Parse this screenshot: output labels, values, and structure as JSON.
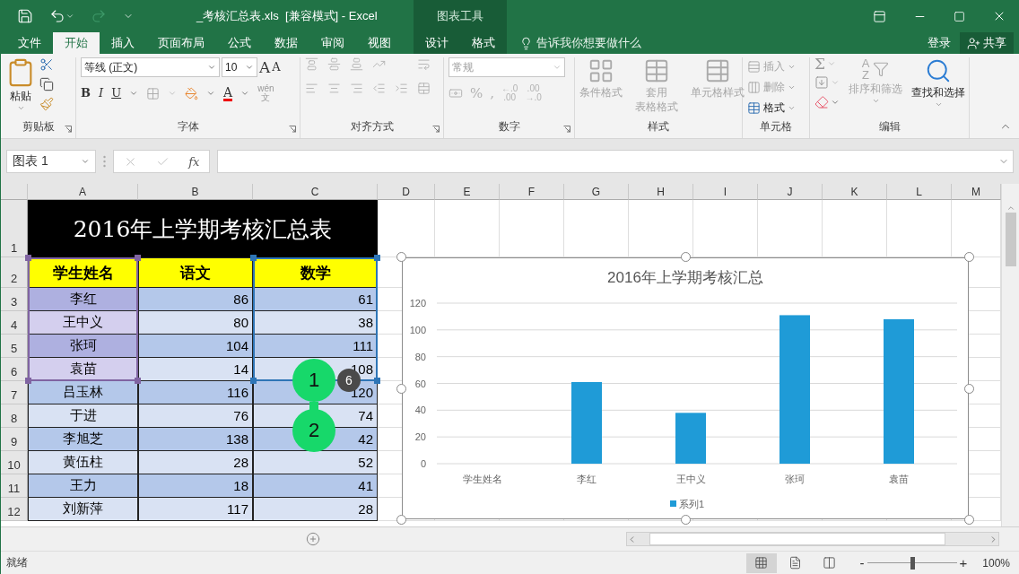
{
  "title_bar": {
    "title": "_考核汇总表.xls  [兼容模式] - Excel",
    "context_label": "图表工具"
  },
  "ribbon_tabs": [
    {
      "label": "文件",
      "selected": false,
      "kind": "normal"
    },
    {
      "label": "开始",
      "selected": true,
      "kind": "normal"
    },
    {
      "label": "插入",
      "selected": false,
      "kind": "normal"
    },
    {
      "label": "页面布局",
      "selected": false,
      "kind": "normal"
    },
    {
      "label": "公式",
      "selected": false,
      "kind": "normal"
    },
    {
      "label": "数据",
      "selected": false,
      "kind": "normal"
    },
    {
      "label": "审阅",
      "selected": false,
      "kind": "normal"
    },
    {
      "label": "视图",
      "selected": false,
      "kind": "normal"
    },
    {
      "label": "设计",
      "selected": false,
      "kind": "context"
    },
    {
      "label": "格式",
      "selected": false,
      "kind": "context"
    }
  ],
  "tell_me": "告诉我你想要做什么",
  "sign_in": "登录",
  "share": "共享",
  "ribbon": {
    "clipboard": {
      "label": "剪贴板",
      "paste": "粘贴"
    },
    "font": {
      "label": "字体",
      "font_name": "等线 (正文)",
      "font_size": "10",
      "grow": "A",
      "shrink": "A",
      "bold": "B",
      "italic": "I",
      "underline": "U",
      "font_color": "A",
      "phonetic": [
        "wén",
        "文"
      ]
    },
    "alignment": {
      "label": "对齐方式",
      "disabled": true
    },
    "number": {
      "label": "数字",
      "disabled": true,
      "format": "常规",
      "percent": "%",
      "comma": ",",
      "decimals": [
        [
          "←.0",
          ".00"
        ],
        [
          ".00",
          "→.0"
        ]
      ]
    },
    "styles": {
      "label": "样式",
      "buttons": [
        {
          "lines": [
            "条件格式"
          ],
          "disabled": true
        },
        {
          "lines": [
            "套用",
            "表格格式"
          ],
          "disabled": true
        },
        {
          "lines": [
            "单元格样式"
          ],
          "disabled": true
        }
      ]
    },
    "cells": {
      "label": "单元格",
      "buttons": [
        {
          "label": "插入",
          "disabled": true
        },
        {
          "label": "删除",
          "disabled": true
        },
        {
          "label": "格式",
          "disabled": false
        }
      ]
    },
    "editing": {
      "label": "编辑",
      "sum": "Σ",
      "sort_letters": [
        "A",
        "Z"
      ],
      "buttons": [
        {
          "label": "排序和筛选",
          "disabled": true
        },
        {
          "label": "查找和选择",
          "disabled": false
        }
      ]
    }
  },
  "formula_bar": {
    "name_box": "图表 1",
    "fx": "fx"
  },
  "sheet": {
    "columns": [
      "A",
      "B",
      "C",
      "D",
      "E",
      "F",
      "G",
      "H",
      "I",
      "J",
      "K",
      "L",
      "M"
    ],
    "row_numbers": [
      "1",
      "2",
      "3",
      "4",
      "5",
      "6",
      "7",
      "8",
      "9",
      "10",
      "11",
      "12"
    ],
    "table_title": "2016年上学期考核汇总表",
    "headers": [
      "学生姓名",
      "语文",
      "数学"
    ],
    "rows": [
      {
        "cells": [
          "李红",
          "86",
          "61"
        ],
        "in_chart_range": true
      },
      {
        "cells": [
          "王中义",
          "80",
          "38"
        ],
        "in_chart_range": true
      },
      {
        "cells": [
          "张珂",
          "104",
          "111"
        ],
        "in_chart_range": true
      },
      {
        "cells": [
          "袁苗",
          "14",
          "108"
        ],
        "in_chart_range": true
      },
      {
        "cells": [
          "吕玉林",
          "116",
          "120"
        ],
        "in_chart_range": false
      },
      {
        "cells": [
          "于进",
          "76",
          "74"
        ],
        "in_chart_range": false
      },
      {
        "cells": [
          "李旭芝",
          "138",
          "42"
        ],
        "in_chart_range": false
      },
      {
        "cells": [
          "黄伍柱",
          "28",
          "52"
        ],
        "in_chart_range": false
      },
      {
        "cells": [
          "王力",
          "18",
          "41"
        ],
        "in_chart_range": false
      },
      {
        "cells": [
          "刘新萍",
          "117",
          "28"
        ],
        "in_chart_range": false
      }
    ],
    "chart_ranges": [
      {
        "kind": "categories",
        "color": "#8064a2"
      },
      {
        "kind": "values",
        "color": "#2e75b6"
      }
    ]
  },
  "chart": {
    "selected": true,
    "chart_data": {
      "type": "bar",
      "title": "2016年上学期考核汇总",
      "categories": [
        "学生姓名",
        "李红",
        "王中义",
        "张珂",
        "袁苗"
      ],
      "series": [
        {
          "name": "系列1",
          "color": "#1f9bd7",
          "values": [
            null,
            61,
            38,
            111,
            108
          ]
        }
      ],
      "ylim": [
        0,
        120
      ],
      "grid": true,
      "yticks": [
        0,
        20,
        40,
        60,
        80,
        100,
        120
      ]
    }
  },
  "step_markers": [
    {
      "label": "1"
    },
    {
      "label": "2"
    }
  ],
  "count_badge": "6",
  "status_bar": {
    "status": "就绪",
    "views": [
      {
        "kind": "normal",
        "selected": true
      },
      {
        "kind": "page_layout",
        "selected": false
      },
      {
        "kind": "page_break",
        "selected": false
      }
    ],
    "zoom_out": "-",
    "zoom_in": "+",
    "zoom": {
      "level": 0.5
    },
    "zoom_label": "100%"
  }
}
